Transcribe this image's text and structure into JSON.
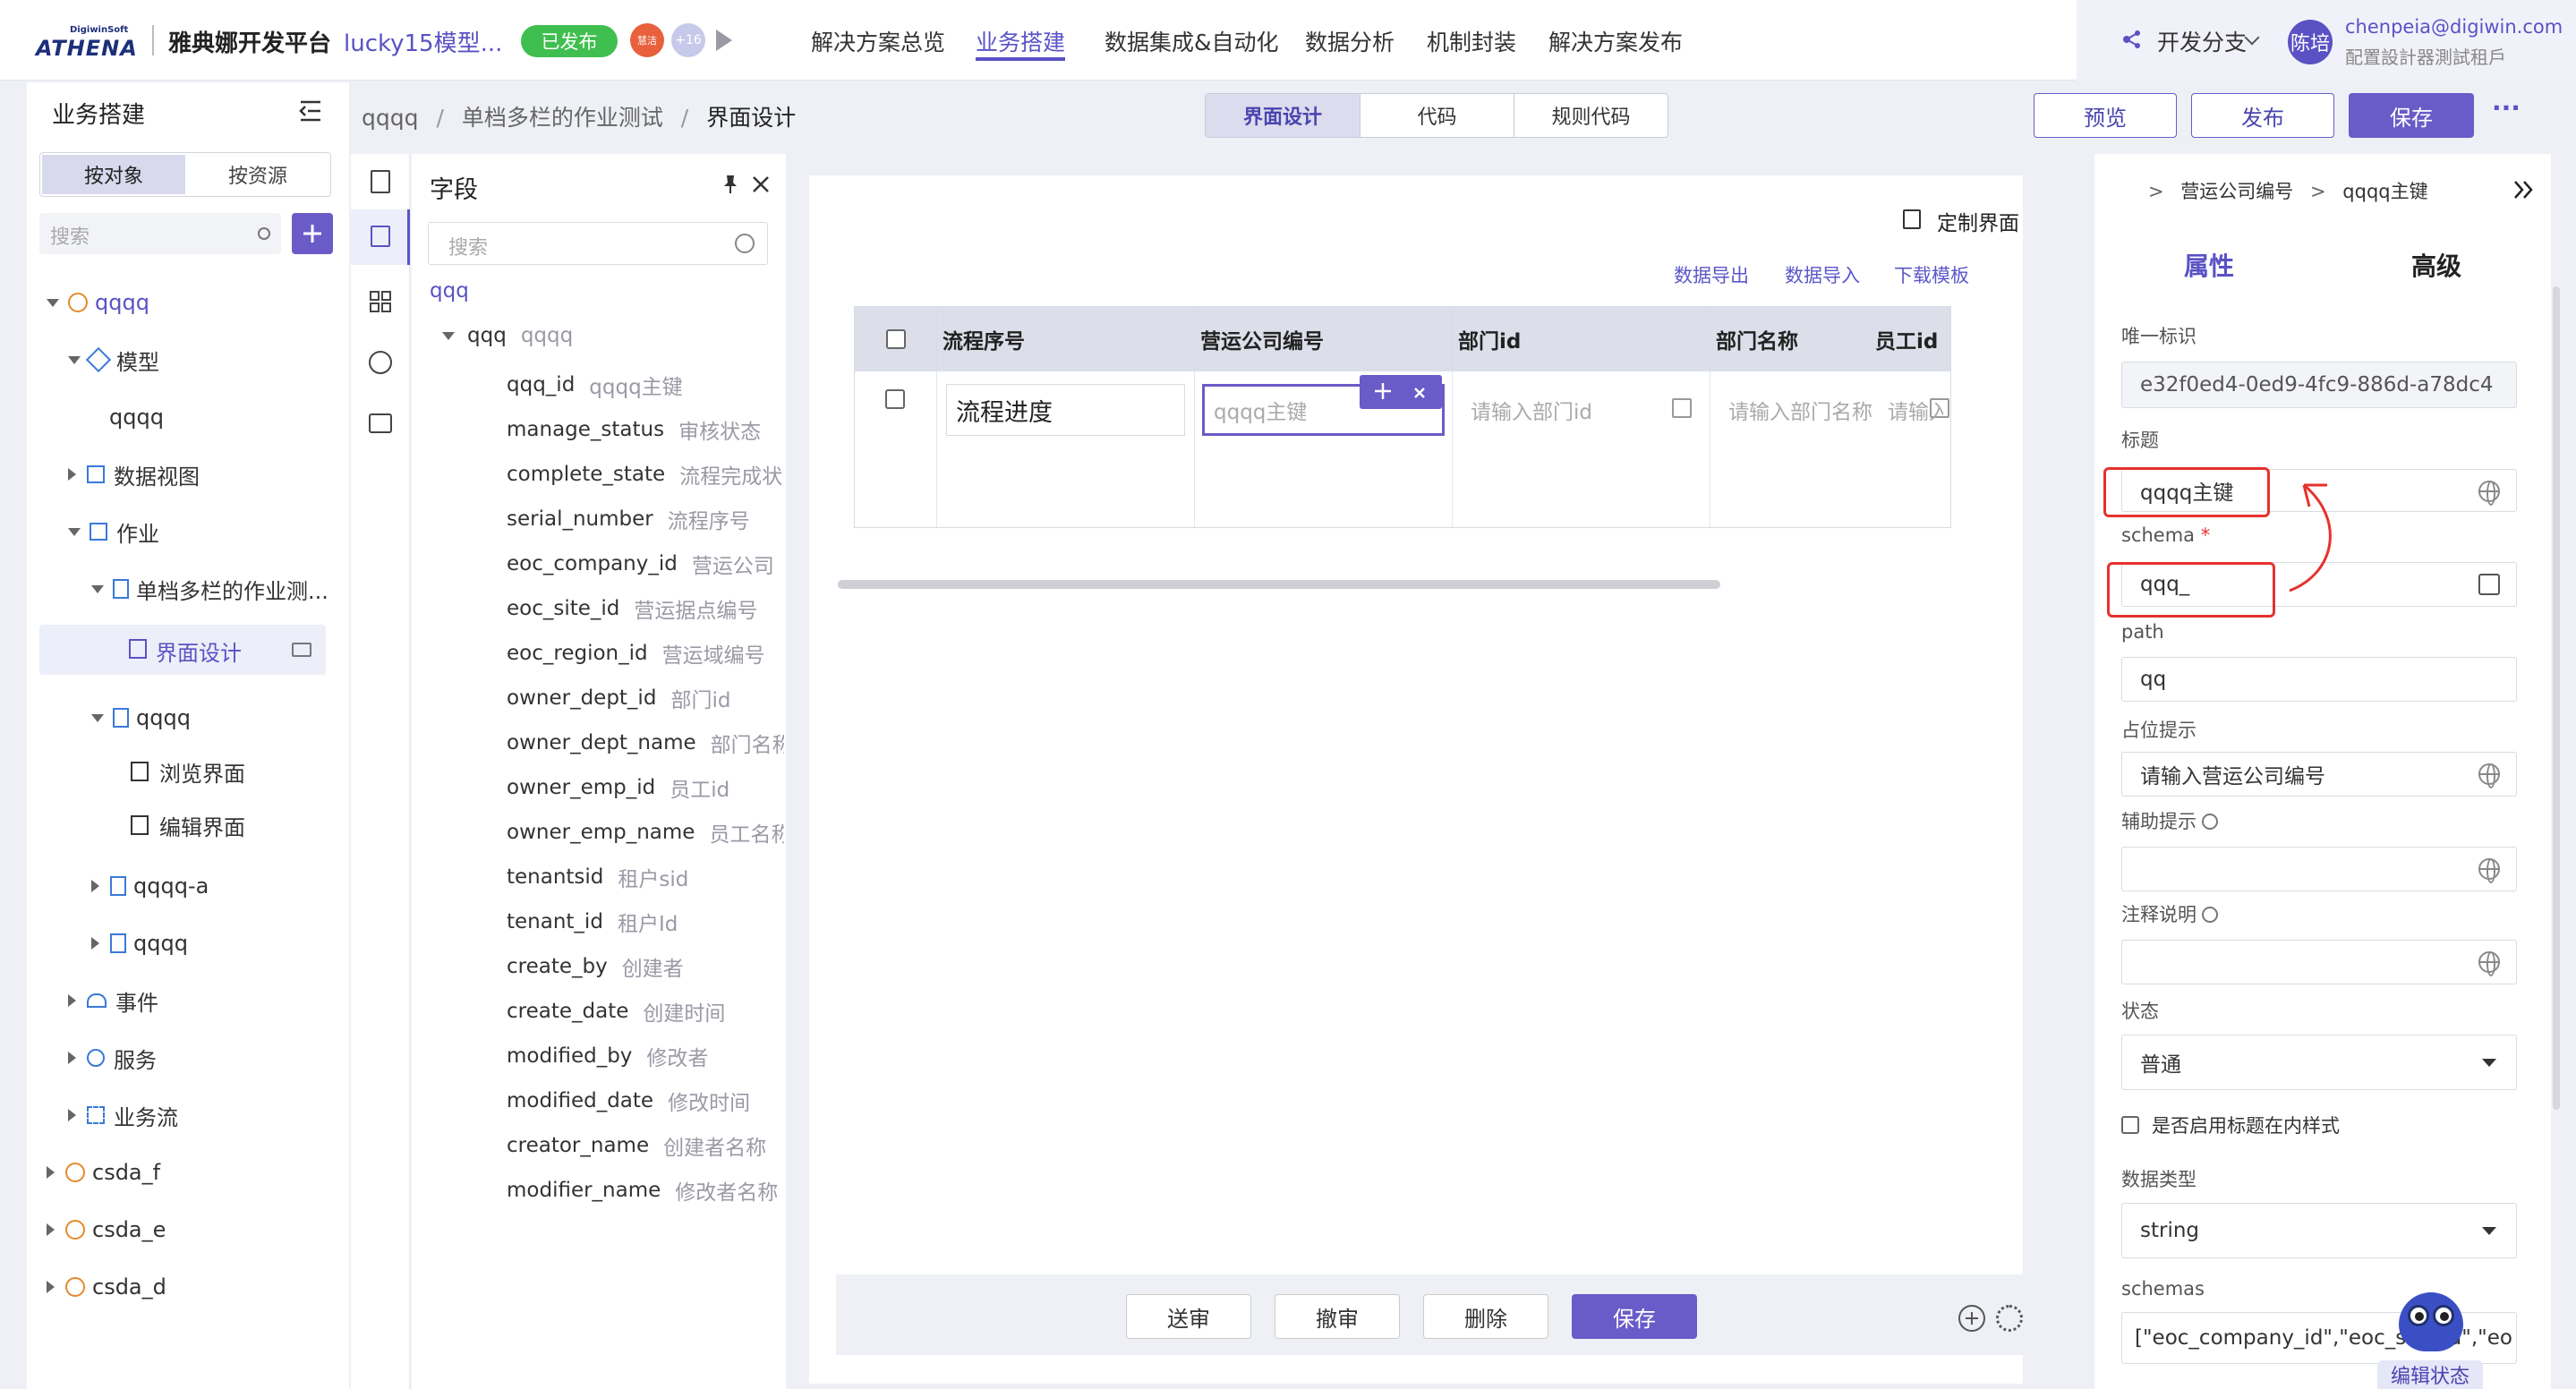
{
  "topbar": {
    "brand_small": "DigiwinSoft",
    "brand_logo": "ATHENA",
    "platform": "雅典娜开发平台",
    "project": "lucky15模型...",
    "publish_badge": "已发布",
    "avatar1": "慧洁",
    "avatar_more": "+16",
    "nav": [
      "解决方案总览",
      "业务搭建",
      "数据集成&自动化",
      "数据分析",
      "机制封装",
      "解决方案发布"
    ],
    "branch": "开发分支",
    "user_avatar": "陈培",
    "user_email": "chenpeia@digiwin.com",
    "user_tenant": "配置設計器測試租戶"
  },
  "sidebar": {
    "title": "业务搭建",
    "tab_object": "按对象",
    "tab_resource": "按资源",
    "search_placeholder": "搜索",
    "tree": [
      {
        "label": "qqqq"
      },
      {
        "label": "模型"
      },
      {
        "label": "qqqq"
      },
      {
        "label": "数据视图"
      },
      {
        "label": "作业"
      },
      {
        "label": "单档多栏的作业测..."
      },
      {
        "label": "界面设计"
      },
      {
        "label": "qqqq"
      },
      {
        "label": "浏览界面"
      },
      {
        "label": "编辑界面"
      },
      {
        "label": "qqqq-a"
      },
      {
        "label": "qqqq"
      },
      {
        "label": "事件"
      },
      {
        "label": "服务"
      },
      {
        "label": "业务流"
      },
      {
        "label": "csda_f"
      },
      {
        "label": "csda_e"
      },
      {
        "label": "csda_d"
      }
    ]
  },
  "breadcrumb": {
    "p1": "qqqq",
    "p2": "单档多栏的作业测试",
    "p3": "界面设计",
    "sep": "/"
  },
  "viewtabs": [
    "界面设计",
    "代码",
    "规则代码"
  ],
  "actions": {
    "preview": "预览",
    "publish": "发布",
    "save": "保存",
    "more": "···"
  },
  "fields": {
    "title": "字段",
    "search_placeholder": "搜索",
    "root": "qqq",
    "group_name": "qqq",
    "group_desc": "qqqq",
    "items": [
      {
        "name": "qqq_id",
        "desc": "qqqq主键"
      },
      {
        "name": "manage_status",
        "desc": "审核状态"
      },
      {
        "name": "complete_state",
        "desc": "流程完成状"
      },
      {
        "name": "serial_number",
        "desc": "流程序号"
      },
      {
        "name": "eoc_company_id",
        "desc": "营运公司"
      },
      {
        "name": "eoc_site_id",
        "desc": "营运据点编号"
      },
      {
        "name": "eoc_region_id",
        "desc": "营运域编号"
      },
      {
        "name": "owner_dept_id",
        "desc": "部门id"
      },
      {
        "name": "owner_dept_name",
        "desc": "部门名称"
      },
      {
        "name": "owner_emp_id",
        "desc": "员工id"
      },
      {
        "name": "owner_emp_name",
        "desc": "员工名称"
      },
      {
        "name": "tenantsid",
        "desc": "租户sid"
      },
      {
        "name": "tenant_id",
        "desc": "租户Id"
      },
      {
        "name": "create_by",
        "desc": "创建者"
      },
      {
        "name": "create_date",
        "desc": "创建时间"
      },
      {
        "name": "modified_by",
        "desc": "修改者"
      },
      {
        "name": "modified_date",
        "desc": "修改时间"
      },
      {
        "name": "creator_name",
        "desc": "创建者名称"
      },
      {
        "name": "modifier_name",
        "desc": "修改者名称"
      }
    ]
  },
  "canvas": {
    "custom_ui": "定制界面",
    "data_export": "数据导出",
    "data_import": "数据导入",
    "download_template": "下载模板",
    "columns": [
      "流程序号",
      "营运公司编号",
      "部门id",
      "部门名称",
      "员工id"
    ],
    "cells": [
      "流程进度",
      "qqqq主键",
      "请输入部门id",
      "请输入部门名称",
      "请输入"
    ],
    "footer_buttons": [
      "送审",
      "撤审",
      "删除",
      "保存"
    ]
  },
  "props": {
    "crumb1": "营运公司编号",
    "crumb2": "qqqq主键",
    "tab_attr": "属性",
    "tab_adv": "高级",
    "uid_label": "唯一标识",
    "uid_value": "e32f0ed4-0ed9-4fc9-886d-a78dc4",
    "title_label": "标题",
    "title_value": "qqqq主键",
    "schema_label": "schema",
    "schema_value": "qqq_",
    "path_label": "path",
    "path_value": "qq",
    "placeholder_label": "占位提示",
    "placeholder_value": "请输入营运公司编号",
    "help_label": "辅助提示",
    "note_label": "注释说明",
    "status_label": "状态",
    "status_value": "普通",
    "inline_title_check": "是否启用标题在内样式",
    "dtype_label": "数据类型",
    "dtype_value": "string",
    "schemas_label": "schemas",
    "schemas_value": "[\"eoc_company_id\",\"eoc_site_id\",\"eo",
    "edit_state": "编辑状态"
  },
  "colors": {
    "accent": "#6a5bc8",
    "annotation": "#e5322d",
    "publish_green": "#3fbf4f",
    "link": "#5b57c9"
  }
}
